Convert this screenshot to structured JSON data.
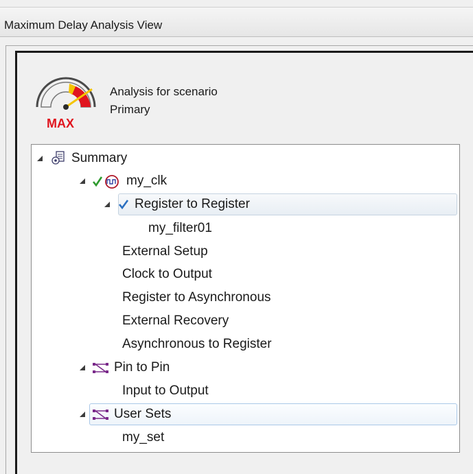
{
  "window": {
    "title": "Maximum Delay Analysis View"
  },
  "header": {
    "gauge_label": "MAX",
    "line1": "Analysis for scenario",
    "line2": "Primary"
  },
  "tree": {
    "summary": "Summary",
    "clock": "my_clk",
    "reg_to_reg": "Register to Register",
    "filter": "my_filter01",
    "external_setup": "External Setup",
    "clock_to_output": "Clock to Output",
    "reg_to_async": "Register to Asynchronous",
    "external_recovery": "External Recovery",
    "async_to_reg": "Asynchronous to Register",
    "pin_to_pin": "Pin to Pin",
    "input_to_output": "Input to Output",
    "user_sets": "User Sets",
    "my_set": "my_set"
  },
  "colors": {
    "gauge_red": "#e0141e",
    "gauge_yellow": "#f4c400",
    "check_green": "#2e9a2e",
    "clock_red": "#b0182a",
    "set_purple": "#7a2a8a"
  }
}
